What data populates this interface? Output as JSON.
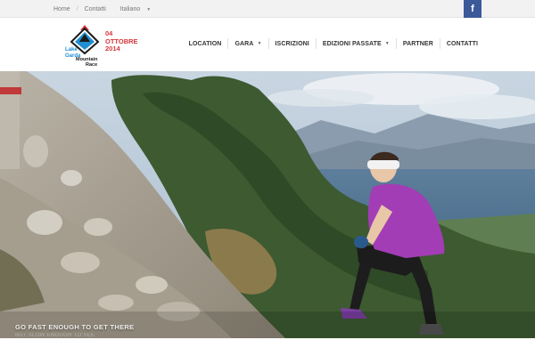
{
  "topbar": {
    "links": [
      "Home",
      "Contatti"
    ],
    "language": "Italiano",
    "facebook_label": "f"
  },
  "logo": {
    "brand_lines": [
      "Lake",
      "Garda",
      "Mountain",
      "Race"
    ],
    "date_lines": [
      "04",
      "OTTOBRE",
      "2014"
    ]
  },
  "nav": {
    "items": [
      {
        "label": "LOCATION",
        "dropdown": false
      },
      {
        "label": "GARA",
        "dropdown": true
      },
      {
        "label": "ISCRIZIONI",
        "dropdown": false
      },
      {
        "label": "EDIZIONI PASSATE",
        "dropdown": true
      },
      {
        "label": "PARTNER",
        "dropdown": false
      },
      {
        "label": "CONTATTI",
        "dropdown": false
      }
    ]
  },
  "hero": {
    "caption": "GO FAST ENOUGH TO GET THERE",
    "caption_sub": "BUT SLOW ENOUGH TO SEE"
  },
  "colors": {
    "brand_red": "#d8363b",
    "brand_blue": "#1f8fd1",
    "facebook": "#3b5998",
    "runner_shirt": "#a23db5"
  }
}
